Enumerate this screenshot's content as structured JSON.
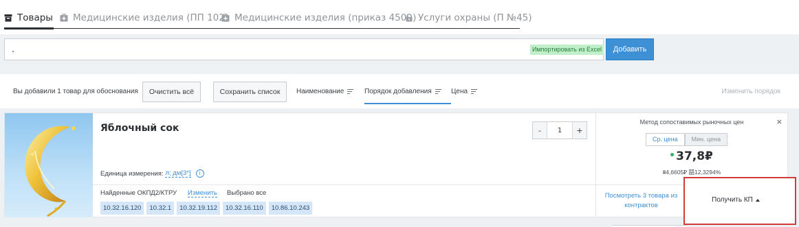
{
  "tabs": [
    {
      "label": "Товары",
      "icon": "box-icon",
      "active": true
    },
    {
      "label": "Медицинские изделия (ПП 102)",
      "icon": "medkit-icon",
      "active": false
    },
    {
      "label": "Медицинские изделия (приказ 450н)",
      "icon": "medkit-icon",
      "active": false
    },
    {
      "label": "Услуги охраны (П №45)",
      "icon": "lock-icon",
      "active": false
    }
  ],
  "search": {
    "value": ".",
    "excel_label": "Импортировать из Excel",
    "add_label": "Добавить"
  },
  "toolbar": {
    "added_text": "Вы добавили 1 товар для обоснования",
    "clear_label": "Очистить всё",
    "save_label": "Сохранить список",
    "sort": [
      {
        "label": "Наименование",
        "active": false
      },
      {
        "label": "Порядок добавления",
        "active": true
      },
      {
        "label": "Цена",
        "active": false
      }
    ],
    "reorder_label": "Изменить порядок"
  },
  "product": {
    "title": "Яблочный сок",
    "quantity": "1",
    "minus": "-",
    "plus": "+",
    "unit_label": "Единица измерения:",
    "unit_value": "л; дм[3*]",
    "okpd_label": "Найденные ОКПД2/КТРУ",
    "okpd_change": "Изменить",
    "okpd_all": "Выбрано все",
    "codes": [
      "10.32.16.120",
      "10.32.1",
      "10.32.19.112",
      "10.32.16.110",
      "10.86.10.243"
    ]
  },
  "price": {
    "method": "Метод сопоставимых рыночных цен",
    "close": "×",
    "tab_avg": "Ср. цена",
    "tab_min": "Мин. цена",
    "value": "37,8₽",
    "stats": "⩩4,6605₽ 㗊12,3294%",
    "contracts": "Посмотреть 3 товара из контрактов",
    "kp_label": "Получить КП"
  },
  "colors": {
    "accent": "#3d8fd6",
    "highlight": "#d23b3b",
    "excel_badge": "#bff0c9",
    "chip": "#d4e6f8"
  }
}
